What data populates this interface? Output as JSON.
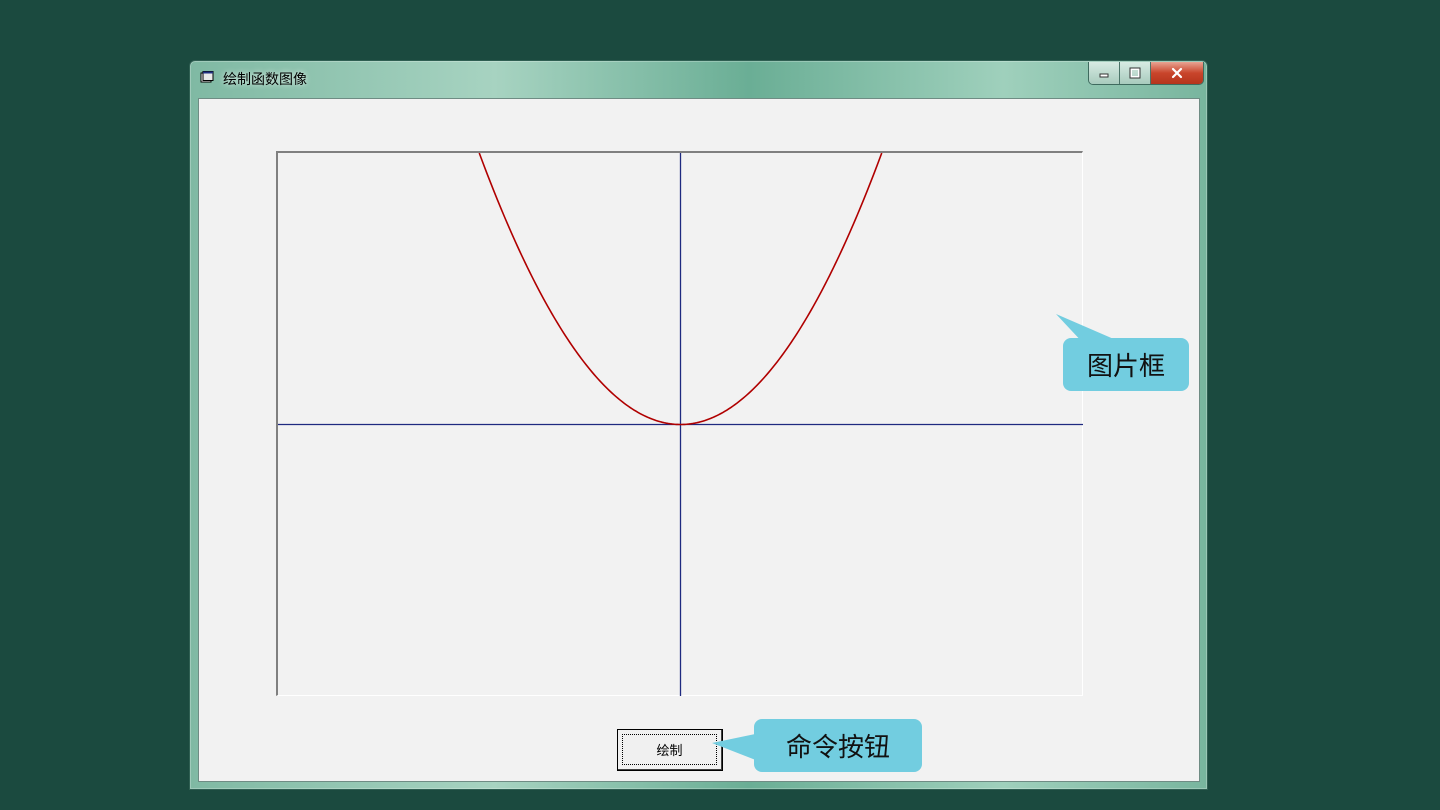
{
  "window": {
    "title": "绘制函数图像",
    "icon": "vb-form-icon",
    "controls": [
      "minimize-icon",
      "maximize-icon",
      "close-icon"
    ]
  },
  "form": {
    "button_label": "绘制"
  },
  "callouts": {
    "picture_box": "图片框",
    "command_button": "命令按钮"
  },
  "chart_data": {
    "type": "line",
    "function": "y = x^2",
    "series": [
      {
        "x": [
          -1.0,
          -0.75,
          -0.5,
          -0.25,
          0.0,
          0.25,
          0.5,
          0.75,
          1.0
        ],
        "y": [
          1.0,
          0.5625,
          0.25,
          0.0625,
          0.0,
          0.0625,
          0.25,
          0.5625,
          1.0
        ]
      }
    ],
    "xlim": [
      -2.0,
      2.0
    ],
    "ylim": [
      -1.0,
      1.0
    ],
    "grid": false,
    "axes_color": "#1f2a80",
    "curve_color": "#b00000"
  },
  "colors": {
    "background": "#1b4a3f",
    "callout": "#72cde0"
  }
}
